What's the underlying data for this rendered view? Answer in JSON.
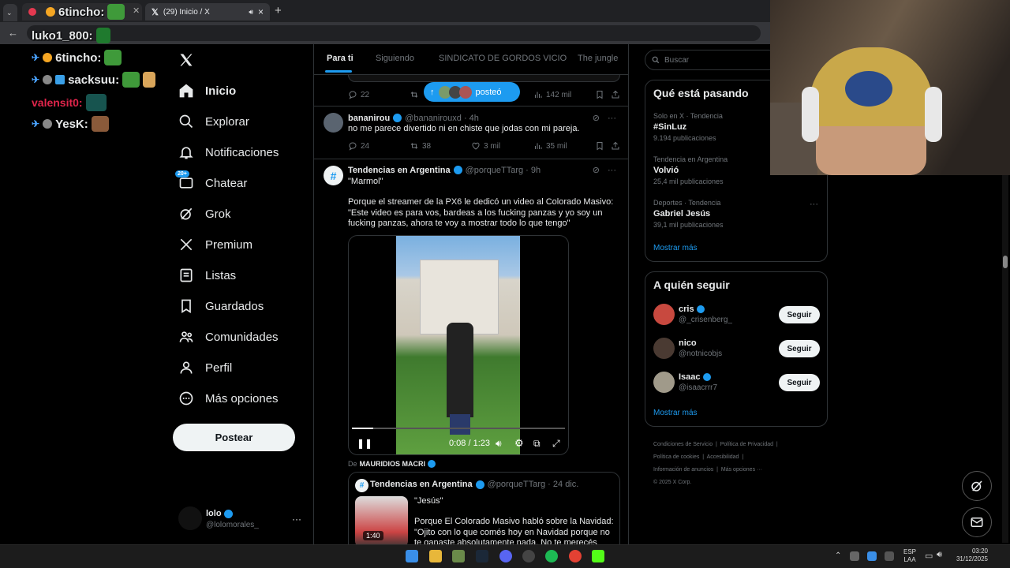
{
  "browser": {
    "tabs": [
      {
        "label": "6tincho:"
      },
      {
        "label": "(29) Inicio / X",
        "close": "×"
      }
    ],
    "new_tab": "+",
    "address": "luko1_800: home"
  },
  "chat_overlay": [
    {
      "user": "6tincho:",
      "color": "#ffffff"
    },
    {
      "user": "luko1_800:",
      "color": "#ffffff"
    },
    {
      "user": "6tincho:",
      "color": "#ffffff"
    },
    {
      "user": "sacksuu:",
      "color": "#ffffff"
    },
    {
      "user": "valensit0:",
      "color": "#e0254b"
    },
    {
      "user": "YesK:",
      "color": "#ffffff"
    }
  ],
  "nav": {
    "items": [
      {
        "label": "Inicio",
        "icon": "home-icon"
      },
      {
        "label": "Explorar",
        "icon": "search-icon"
      },
      {
        "label": "Notificaciones",
        "icon": "bell-icon"
      },
      {
        "label": "Chatear",
        "icon": "mail-icon",
        "badge": "20+"
      },
      {
        "label": "Grok",
        "icon": "grok-icon"
      },
      {
        "label": "Premium",
        "icon": "x-icon"
      },
      {
        "label": "Listas",
        "icon": "list-icon"
      },
      {
        "label": "Guardados",
        "icon": "bookmark-icon"
      },
      {
        "label": "Comunidades",
        "icon": "people-icon"
      },
      {
        "label": "Perfil",
        "icon": "person-icon"
      },
      {
        "label": "Más opciones",
        "icon": "more-circle-icon"
      }
    ],
    "post_button": "Postear",
    "account": {
      "name": "lolo",
      "handle": "@lolomorales_",
      "more": "···"
    }
  },
  "feed": {
    "tabs": [
      "Para ti",
      "Siguiendo",
      "SINDICATO DE GORDOS VICIO",
      "The jungle"
    ],
    "posted_pill": "posteó",
    "tweet0_actions": {
      "replies": "22",
      "views": "142 mil"
    },
    "tweet1": {
      "name": "bananirou",
      "handle": "@bananirouxd · 4h",
      "text": "no me parece divertido ni en chiste que jodas con mi pareja.",
      "replies": "24",
      "retweets": "38",
      "likes": "3 mil",
      "views": "35 mil"
    },
    "tweet2": {
      "name": "Tendencias en Argentina",
      "handle": "@porqueTTarg · 9h",
      "line1": "\"Marmol\"",
      "body": "Porque el streamer de la PX6 le dedicó un video al Colorado Masivo: \"Este video es para vos, bardeas a los fucking panzas y yo soy un fucking panzas, ahora te voy a mostrar todo lo que tengo\"",
      "video_time": "0:08 / 1:23",
      "video_progress": 0.1
    },
    "quote": {
      "via_prefix": "De",
      "via_name": "MAURIDIOS MACRI",
      "name": "Tendencias en Argentina",
      "handle": "@porqueTTarg · 24 dic.",
      "line1": "\"Jesús\"",
      "body": "Porque El Colorado Masivo habló sobre la Navidad: \"Ojito con lo que comés hoy en Navidad porque no te ganaste absolutamente nada. No te merecés esas",
      "thumb_time": "1:40"
    }
  },
  "right": {
    "search_placeholder": "Buscar",
    "trends_title": "Qué está pasando",
    "trends": [
      {
        "context": "Solo en X · Tendencia",
        "topic": "#SinLuz",
        "count": "9.194 publicaciones"
      },
      {
        "context": "Tendencia en Argentina",
        "topic": "Volvió",
        "count": "25,4 mil publicaciones"
      },
      {
        "context": "Deportes · Tendencia",
        "topic": "Gabriel Jesús",
        "count": "39,1 mil publicaciones"
      }
    ],
    "trends_more": "Mostrar más",
    "follow_title": "A quién seguir",
    "follow": [
      {
        "name": "cris",
        "handle": "@_crisenberg_",
        "verified": true,
        "button": "Seguir"
      },
      {
        "name": "nico",
        "handle": "@notnicobjs",
        "verified": false,
        "button": "Seguir"
      },
      {
        "name": "Isaac",
        "handle": "@isaacrrr7",
        "verified": true,
        "button": "Seguir"
      }
    ],
    "follow_more": "Mostrar más",
    "footer": {
      "line1a": "Condiciones de Servicio",
      "line1b": "Política de Privacidad",
      "line2a": "Política de cookies",
      "line2b": "Accesibilidad",
      "line3a": "Información de anuncios",
      "line3b": "Más opciones ···",
      "copyright": "© 2025 X Corp."
    }
  },
  "taskbar": {
    "lang1": "ESP",
    "lang2": "LAA",
    "time": "03:20",
    "date": "31/12/2025"
  },
  "colors": {
    "accent": "#1d9bf0",
    "background": "#000000",
    "border": "#2f3336",
    "muted": "#71767b"
  }
}
